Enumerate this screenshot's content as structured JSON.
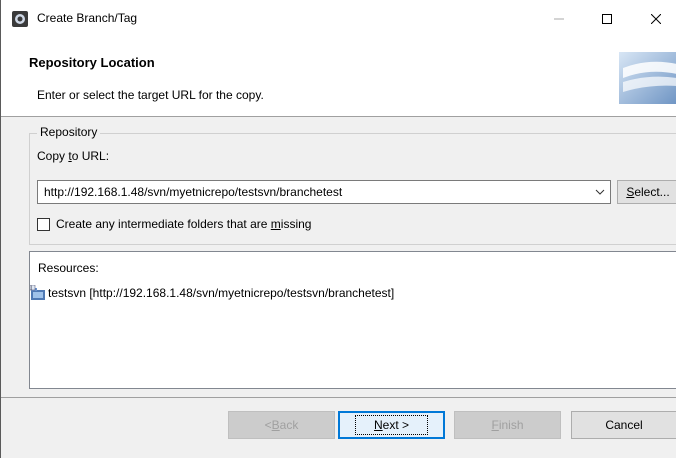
{
  "window": {
    "title": "Create Branch/Tag"
  },
  "header": {
    "title": "Repository Location",
    "description": "Enter or select the target URL for the copy."
  },
  "repository": {
    "legend": "Repository",
    "copy_label_prefix": "Copy ",
    "copy_label_mnemonic": "t",
    "copy_label_suffix": "o URL:",
    "url_value": "http://192.168.1.48/svn/myetnicrepo/testsvn/branchetest",
    "select_prefix": "",
    "select_mnemonic": "S",
    "select_suffix": "elect...",
    "checkbox_prefix": "Create any intermediate folders that are ",
    "checkbox_mnemonic": "m",
    "checkbox_suffix": "issing",
    "checkbox_checked": false
  },
  "resources": {
    "label": "Resources:",
    "items": [
      {
        "text": "testsvn [http://192.168.1.48/svn/myetnicrepo/testsvn/branchetest]"
      }
    ]
  },
  "buttons": {
    "back_prefix": "< ",
    "back_mnemonic": "B",
    "back_suffix": "ack",
    "next_mnemonic": "N",
    "next_suffix": "ext >",
    "finish_mnemonic": "F",
    "finish_suffix": "inish",
    "cancel": "Cancel"
  }
}
